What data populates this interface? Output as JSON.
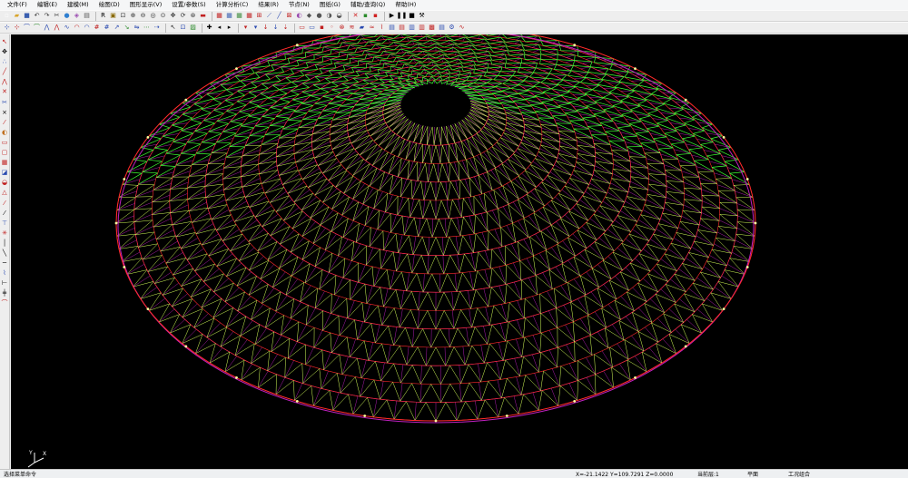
{
  "menu": [
    {
      "label": "文件(F)"
    },
    {
      "label": "编辑(E)"
    },
    {
      "label": "建模(M)"
    },
    {
      "label": "绘图(D)"
    },
    {
      "label": "图形显示(V)"
    },
    {
      "label": "设置/参数(S)"
    },
    {
      "label": "计算分析(C)"
    },
    {
      "label": "结果(R)"
    },
    {
      "label": "节点(N)"
    },
    {
      "label": "图纸(G)"
    },
    {
      "label": "辅助/查询(Q)"
    },
    {
      "label": "帮助(H)"
    }
  ],
  "toolbar_row1": [
    {
      "icon": "new-file-icon",
      "glyph": "▫",
      "color": "#ffffff"
    },
    {
      "icon": "open-folder-icon",
      "glyph": "▰",
      "color": "#d9a52c"
    },
    {
      "icon": "save-icon",
      "glyph": "■",
      "color": "#3a5fb0"
    },
    {
      "icon": "undo-icon",
      "glyph": "↶",
      "color": "#333333"
    },
    {
      "icon": "redo-icon",
      "glyph": "↷",
      "color": "#333333"
    },
    {
      "icon": "cut-icon",
      "glyph": "✂",
      "color": "#333333"
    },
    {
      "icon": "globe-icon",
      "glyph": "●",
      "color": "#2f7fd0"
    },
    {
      "icon": "view3d-icon",
      "glyph": "◈",
      "color": "#9a4ab0"
    },
    {
      "icon": "print-icon",
      "glyph": "▤",
      "color": "#555555"
    },
    {
      "sep": true
    },
    {
      "icon": "redraw-icon",
      "glyph": "R",
      "color": "#000000"
    },
    {
      "icon": "frame-icon",
      "glyph": "▣",
      "color": "#8a6a00"
    },
    {
      "icon": "zoom-window-icon",
      "glyph": "⊡",
      "color": "#333333"
    },
    {
      "icon": "zoom-in-icon",
      "glyph": "⊕",
      "color": "#333333"
    },
    {
      "icon": "zoom-out-icon",
      "glyph": "⊖",
      "color": "#333333"
    },
    {
      "icon": "zoom-all-icon",
      "glyph": "◎",
      "color": "#333333"
    },
    {
      "icon": "zoom-extents-icon",
      "glyph": "⊙",
      "color": "#333333"
    },
    {
      "icon": "pan-icon",
      "glyph": "✥",
      "color": "#333333"
    },
    {
      "icon": "rotate-icon",
      "glyph": "⟳",
      "color": "#333333"
    },
    {
      "icon": "orbit-icon",
      "glyph": "⊛",
      "color": "#333333"
    },
    {
      "icon": "display-toggle-icon",
      "glyph": "▬",
      "color": "#c22020"
    },
    {
      "sep": true
    },
    {
      "icon": "grid-icon",
      "glyph": "▦",
      "color": "#c02020"
    },
    {
      "icon": "grid2-icon",
      "glyph": "▦",
      "color": "#3a5fb0"
    },
    {
      "icon": "grid3-icon",
      "glyph": "▦",
      "color": "#3a8a3a"
    },
    {
      "icon": "table-icon",
      "glyph": "▦",
      "color": "#c02020"
    },
    {
      "icon": "axes-icon",
      "glyph": "⊞",
      "color": "#c02020"
    },
    {
      "icon": "line-icon",
      "glyph": "⟋",
      "color": "#2a4ab0"
    },
    {
      "icon": "member-icon",
      "glyph": "╱",
      "color": "#2a4ab0"
    },
    {
      "icon": "node-icon",
      "glyph": "⊠",
      "color": "#c02020"
    },
    {
      "icon": "shade-icon",
      "glyph": "◐",
      "color": "#9a4ab0"
    },
    {
      "icon": "box-icon",
      "glyph": "◆",
      "color": "#555555"
    },
    {
      "icon": "sphere-icon",
      "glyph": "●",
      "color": "#555555"
    },
    {
      "icon": "light-icon",
      "glyph": "◑",
      "color": "#555555"
    },
    {
      "icon": "render-icon",
      "glyph": "◒",
      "color": "#555555"
    },
    {
      "sep": true
    },
    {
      "icon": "delete-icon",
      "glyph": "✕",
      "color": "#d02020"
    },
    {
      "icon": "palette-icon",
      "glyph": "▪",
      "color": "#2a8a2a"
    },
    {
      "icon": "color-icon",
      "glyph": "▪",
      "color": "#d02020"
    },
    {
      "sep": true
    },
    {
      "icon": "play-icon",
      "glyph": "▶",
      "color": "#000000"
    },
    {
      "icon": "pause-icon",
      "glyph": "❚❚",
      "color": "#000000"
    },
    {
      "icon": "stop-icon",
      "glyph": "■",
      "color": "#000000"
    },
    {
      "icon": "hammer-icon",
      "glyph": "⚒",
      "color": "#000000"
    }
  ],
  "toolbar_row2": [
    {
      "icon": "snap-icon",
      "glyph": "⊹",
      "color": "#2a4ab0"
    },
    {
      "icon": "snap2-icon",
      "glyph": "⊹",
      "color": "#c02020"
    },
    {
      "icon": "trace-icon",
      "glyph": "⌒",
      "color": "#2a4ab0"
    },
    {
      "icon": "trace2-icon",
      "glyph": "⌒",
      "color": "#2a8a2a"
    },
    {
      "icon": "polyline-icon",
      "glyph": "⋀",
      "color": "#2a4ab0"
    },
    {
      "icon": "polyline2-icon",
      "glyph": "⋀",
      "color": "#c02020"
    },
    {
      "icon": "curve-icon",
      "glyph": "∿",
      "color": "#2a4ab0"
    },
    {
      "icon": "arc-icon",
      "glyph": "◠",
      "color": "#c02020"
    },
    {
      "icon": "arc2-icon",
      "glyph": "◠",
      "color": "#2a4ab0"
    },
    {
      "icon": "grid-x-icon",
      "glyph": "#",
      "color": "#c02020"
    },
    {
      "icon": "grid-y-icon",
      "glyph": "#",
      "color": "#2a4ab0"
    },
    {
      "icon": "move-icon",
      "glyph": "↗",
      "color": "#2a4ab0"
    },
    {
      "icon": "copy-icon",
      "glyph": "↘",
      "color": "#2a8a2a"
    },
    {
      "icon": "mirror-icon",
      "glyph": "⇋",
      "color": "#2a4ab0"
    },
    {
      "icon": "array-icon",
      "glyph": "⋯",
      "color": "#2a8a2a"
    },
    {
      "icon": "extend-icon",
      "glyph": "⇢",
      "color": "#2a4ab0"
    },
    {
      "sep": true
    },
    {
      "icon": "select-icon",
      "glyph": "↖",
      "color": "#333333"
    },
    {
      "icon": "window-select-icon",
      "glyph": "⊡",
      "color": "#2a4ab0"
    },
    {
      "icon": "filter-icon",
      "glyph": "▨",
      "color": "#2a8a2a"
    },
    {
      "sep": true
    },
    {
      "icon": "add-icon",
      "glyph": "✚",
      "color": "#000000"
    },
    {
      "icon": "arrow-left-icon",
      "glyph": "◂",
      "color": "#000000"
    },
    {
      "icon": "arrow-right-icon",
      "glyph": "▸",
      "color": "#000000"
    },
    {
      "sep": true
    },
    {
      "icon": "support-icon",
      "glyph": "▾",
      "color": "#c02020"
    },
    {
      "icon": "pin-icon",
      "glyph": "▾",
      "color": "#2a4ab0"
    },
    {
      "icon": "load-icon",
      "glyph": "↓",
      "color": "#c02020"
    },
    {
      "icon": "load2-icon",
      "glyph": "↓",
      "color": "#2a4ab0"
    },
    {
      "icon": "line-load-icon",
      "glyph": "⇣",
      "color": "#c02020"
    },
    {
      "sep": true
    },
    {
      "icon": "section-icon",
      "glyph": "▭",
      "color": "#c02020"
    },
    {
      "icon": "section2-icon",
      "glyph": "▭",
      "color": "#2a4ab0"
    },
    {
      "icon": "material-icon",
      "glyph": "▪",
      "color": "#c02020"
    },
    {
      "icon": "release-icon",
      "glyph": "◦",
      "color": "#c02020"
    },
    {
      "icon": "hinge-icon",
      "glyph": "⊗",
      "color": "#c02020"
    },
    {
      "icon": "spring-icon",
      "glyph": "≋",
      "color": "#c02020"
    },
    {
      "icon": "mass-icon",
      "glyph": "▰",
      "color": "#2a4ab0"
    },
    {
      "icon": "wind-icon",
      "glyph": "≈",
      "color": "#c02020"
    },
    {
      "icon": "seismic-icon",
      "glyph": "⌇",
      "color": "#c02020"
    },
    {
      "icon": "check-icon",
      "glyph": "▤",
      "color": "#2a4ab0"
    },
    {
      "icon": "report-icon",
      "glyph": "▤",
      "color": "#c02020"
    },
    {
      "icon": "group-icon",
      "glyph": "▥",
      "color": "#2a4ab0"
    },
    {
      "icon": "layer-icon",
      "glyph": "▥",
      "color": "#c02020"
    },
    {
      "icon": "chart-icon",
      "glyph": "▩",
      "color": "#c02020"
    },
    {
      "icon": "table2-icon",
      "glyph": "▤",
      "color": "#2a4ab0"
    },
    {
      "icon": "design-icon",
      "glyph": "⚙",
      "color": "#2a4ab0"
    },
    {
      "icon": "wave-icon",
      "glyph": "∿",
      "color": "#c02020"
    }
  ],
  "left_toolbar": [
    {
      "icon": "pointer-icon",
      "glyph": "↖",
      "color": "#c02020"
    },
    {
      "icon": "move4-icon",
      "glyph": "✥",
      "color": "#000000"
    },
    {
      "icon": "node-add-icon",
      "glyph": "∴",
      "color": "#2a4ab0"
    },
    {
      "icon": "line-draw-icon",
      "glyph": "╱",
      "color": "#c02020"
    },
    {
      "icon": "polyline-draw-icon",
      "glyph": "⋀",
      "color": "#c02020"
    },
    {
      "icon": "erase-icon",
      "glyph": "✕",
      "color": "#c02020"
    },
    {
      "icon": "trim-icon",
      "glyph": "✂",
      "color": "#2a4ab0"
    },
    {
      "icon": "break-icon",
      "glyph": "×",
      "color": "#000000"
    },
    {
      "icon": "split-icon",
      "glyph": "⁄",
      "color": "#c02020"
    },
    {
      "icon": "brace-icon",
      "glyph": "◐",
      "color": "#c07020"
    },
    {
      "icon": "rect-icon",
      "glyph": "▭",
      "color": "#c02020"
    },
    {
      "icon": "rect2-icon",
      "glyph": "▢",
      "color": "#c02020"
    },
    {
      "icon": "mesh-icon",
      "glyph": "▦",
      "color": "#c02020"
    },
    {
      "icon": "shell-icon",
      "glyph": "◪",
      "color": "#2a4ab0"
    },
    {
      "icon": "dome-icon",
      "glyph": "◒",
      "color": "#c02020"
    },
    {
      "icon": "cone-icon",
      "glyph": "△",
      "color": "#c02020"
    },
    {
      "icon": "slash-icon",
      "glyph": "⁄",
      "color": "#c02020"
    },
    {
      "icon": "slash2-icon",
      "glyph": "⁄",
      "color": "#000000"
    },
    {
      "icon": "tee-icon",
      "glyph": "⊤",
      "color": "#2a4ab0"
    },
    {
      "icon": "star-icon",
      "glyph": "✳",
      "color": "#c02020"
    },
    {
      "icon": "line-vert-icon",
      "glyph": "│",
      "color": "#000000"
    },
    {
      "icon": "line-diag-icon",
      "glyph": "╲",
      "color": "#000000"
    },
    {
      "icon": "line-horz-icon",
      "glyph": "─",
      "color": "#000000"
    },
    {
      "icon": "zigzag-icon",
      "glyph": "⌇",
      "color": "#2a4ab0"
    },
    {
      "icon": "dim-icon",
      "glyph": "⊢",
      "color": "#000000"
    },
    {
      "icon": "text-icon",
      "glyph": "╪",
      "color": "#000000"
    },
    {
      "icon": "arch-icon",
      "glyph": "⌒",
      "color": "#c02020"
    }
  ],
  "viewport": {
    "background": "#000000",
    "outer_ring_color": "#ff2a2a",
    "purple_color": "#c020c0",
    "green_color": "#3cff32",
    "node_color": "#ffffa0"
  },
  "axis": {
    "y_label": "Y",
    "x_label": "X"
  },
  "status": {
    "prompt": "选择菜单命令",
    "coords": "X=-21.1422 Y=109.7291 Z=0.0000",
    "layer": "当前层:1",
    "view": "平面",
    "mode": "工况组合"
  }
}
